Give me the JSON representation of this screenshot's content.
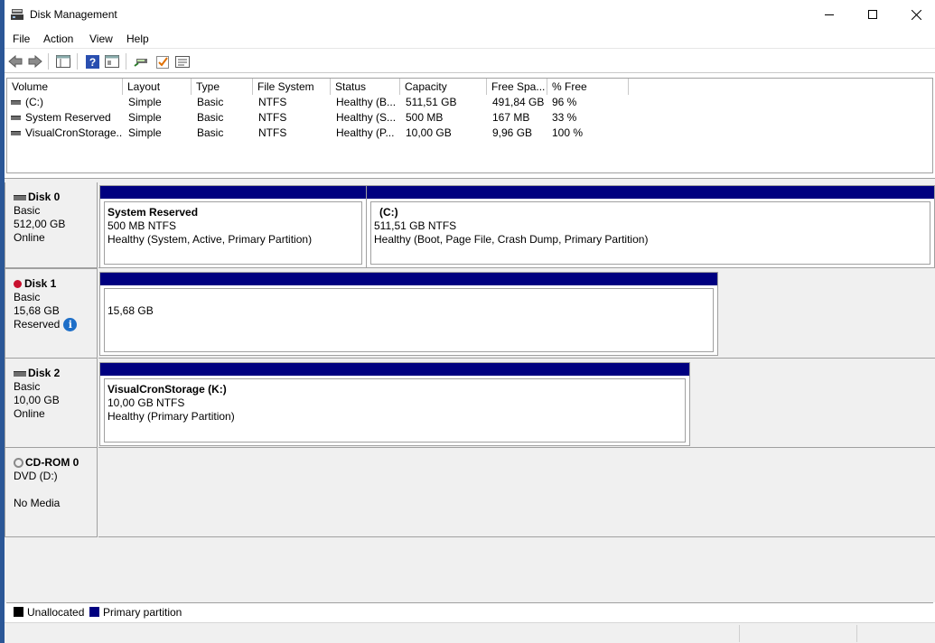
{
  "window": {
    "title": "Disk Management"
  },
  "menu": [
    "File",
    "Action",
    "View",
    "Help"
  ],
  "toolbar": {
    "icons": [
      "back-icon",
      "forward-icon",
      "console-tree-icon",
      "help-icon",
      "properties-icon",
      "connect-disk-icon",
      "check-icon",
      "list-view-icon"
    ]
  },
  "volume_list": {
    "columns": [
      "Volume",
      "Layout",
      "Type",
      "File System",
      "Status",
      "Capacity",
      "Free Spa...",
      "% Free"
    ],
    "rows": [
      {
        "volume": "(C:)",
        "layout": "Simple",
        "type": "Basic",
        "fs": "NTFS",
        "status": "Healthy (B...",
        "capacity": "511,51 GB",
        "free": "491,84 GB",
        "pct": "96 %"
      },
      {
        "volume": "System Reserved",
        "layout": "Simple",
        "type": "Basic",
        "fs": "NTFS",
        "status": "Healthy (S...",
        "capacity": "500 MB",
        "free": "167 MB",
        "pct": "33 %"
      },
      {
        "volume": "VisualCronStorage...",
        "layout": "Simple",
        "type": "Basic",
        "fs": "NTFS",
        "status": "Healthy (P...",
        "capacity": "10,00 GB",
        "free": "9,96 GB",
        "pct": "100 %"
      }
    ]
  },
  "disks": [
    {
      "name": "Disk 0",
      "type": "Basic",
      "size": "512,00 GB",
      "state": "Online",
      "partitions": [
        {
          "name": "System Reserved",
          "size": "500 MB NTFS",
          "status": "Healthy (System, Active, Primary Partition)"
        },
        {
          "name": "(C:)",
          "size": "511,51 GB NTFS",
          "status": "Healthy (Boot, Page File, Crash Dump, Primary Partition)"
        }
      ]
    },
    {
      "name": "Disk 1",
      "type": "Basic",
      "size": "15,68 GB",
      "state": "Reserved",
      "partitions": [
        {
          "name": "",
          "size": "15,68 GB",
          "status": ""
        }
      ]
    },
    {
      "name": "Disk 2",
      "type": "Basic",
      "size": "10,00 GB",
      "state": "Online",
      "partitions": [
        {
          "name": "VisualCronStorage  (K:)",
          "size": "10,00 GB NTFS",
          "status": "Healthy (Primary Partition)"
        }
      ]
    },
    {
      "name": "CD-ROM 0",
      "type": "DVD (D:)",
      "size": "",
      "state": "No Media"
    }
  ],
  "legend": [
    {
      "label": "Unallocated",
      "color": "#000000"
    },
    {
      "label": "Primary partition",
      "color": "#000080"
    }
  ],
  "colors": {
    "partition_bar": "#000080",
    "info": "#1e6fc8",
    "error": "#c8102e"
  }
}
